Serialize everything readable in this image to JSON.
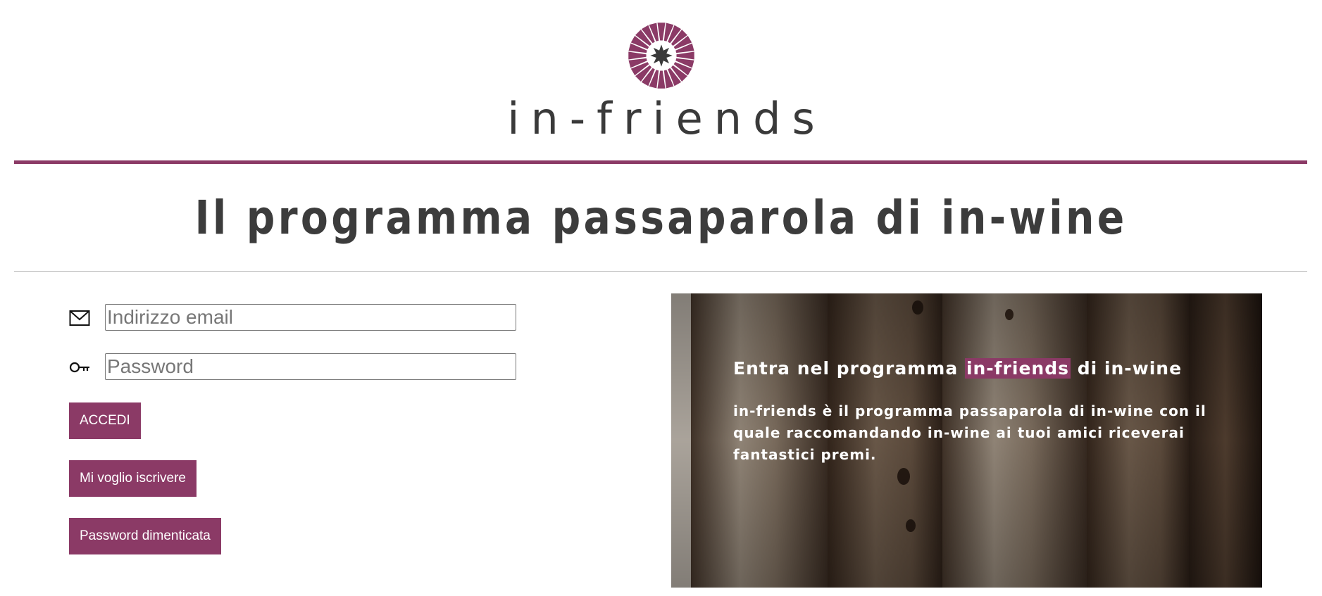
{
  "brand": {
    "name": "in-friends",
    "accent_color": "#8b3a66",
    "logo_icon": "sunburst-star-logo-icon"
  },
  "page": {
    "title": "Il programma passaparola di in-wine"
  },
  "login_form": {
    "email_icon": "envelope-icon",
    "email_placeholder": "Indirizzo email",
    "email_value": "",
    "password_icon": "key-icon",
    "password_placeholder": "Password",
    "password_value": "",
    "login_button": "ACCEDI",
    "signup_button": "Mi voglio iscrivere",
    "forgot_button": "Password dimenticata"
  },
  "hero": {
    "headline_before": "Entra nel programma ",
    "headline_highlight": "in-friends",
    "headline_after": " di in-wine",
    "body": "in-friends è il programma passaparola di in-wine con il quale raccomandando in-wine ai tuoi amici riceverai fantastici premi.",
    "background_image": "wine-corks-photo"
  }
}
